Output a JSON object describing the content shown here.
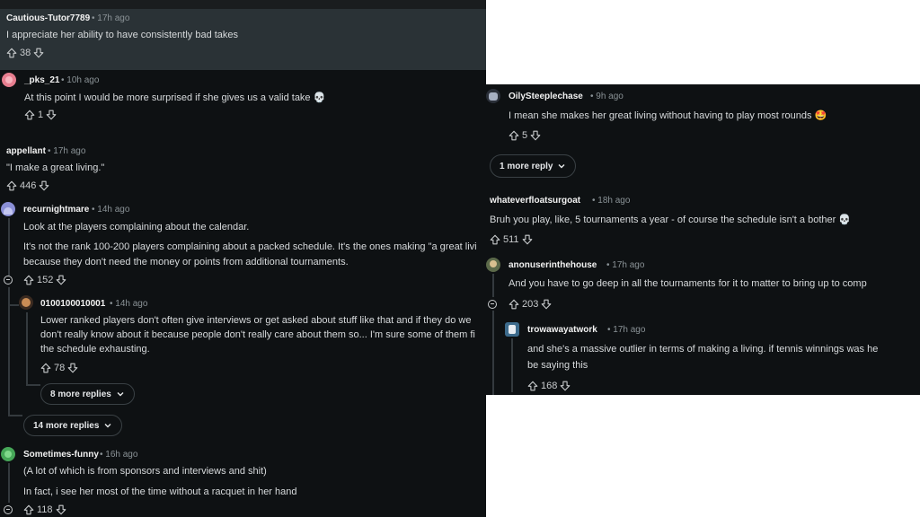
{
  "left": {
    "c1": {
      "user": "Cautious-Tutor7789",
      "time": "• 17h ago",
      "text": "I appreciate her ability to have consistently bad takes",
      "votes": "38"
    },
    "c2": {
      "user": "_pks_21",
      "time": "• 10h ago",
      "text": "At this point I would be more surprised if she gives us a valid take 💀",
      "votes": "1"
    },
    "c3": {
      "user": "appellant",
      "time": "• 17h ago",
      "text": "\"I make a great living.\"",
      "votes": "446"
    },
    "c4": {
      "user": "recurnightmare",
      "time": "• 14h ago",
      "text1": "Look at the players complaining about the calendar.",
      "text2": "It's not the rank 100-200 players complaining about a packed schedule. It's the ones making \"a great livi",
      "text3": "because they don't need the money or points from additional tournaments.",
      "votes": "152"
    },
    "c5": {
      "user": "0100100010001",
      "time": "• 14h ago",
      "text1": "Lower ranked players don't often give interviews or get asked about stuff like that and if they do we",
      "text2": "don't really know about it because people don't really care about them so... I'm sure some of them fi",
      "text3": "the schedule exhausting.",
      "votes": "78"
    },
    "more1": "8 more replies",
    "more2": "14 more replies",
    "c6": {
      "user": "Sometimes-funny",
      "time": "• 16h ago",
      "text1": "(A lot of which is from sponsors and interviews and shit)",
      "text2": "In fact, i see her most of the time without a racquet in her hand",
      "votes": "118"
    }
  },
  "right": {
    "c1": {
      "user": "OilySteeplechase",
      "time": "• 9h ago",
      "text": "I mean she makes her great living without having to play most rounds 🤩",
      "votes": "5"
    },
    "more": "1 more reply",
    "c2": {
      "user": "whateverfloatsurgoat",
      "time": "• 18h ago",
      "text": "Bruh you play, like, 5 tournaments a year - of course the schedule isn't a bother 💀",
      "votes": "511"
    },
    "c3": {
      "user": "anonuserinthehouse",
      "time": "• 17h ago",
      "text": "And you have to go deep in all the tournaments for it to matter to bring up to comp",
      "votes": "203"
    },
    "c4": {
      "user": "trowawayatwork",
      "time": "• 17h ago",
      "text1": "and she's a massive outlier in terms of making a living. if tennis winnings was he",
      "text2": "be saying this",
      "votes": "168"
    }
  },
  "colors": {
    "bg": "#0e1113",
    "highlight": "#2a3236",
    "text": "#d7dadc",
    "meta": "#8a9296"
  }
}
